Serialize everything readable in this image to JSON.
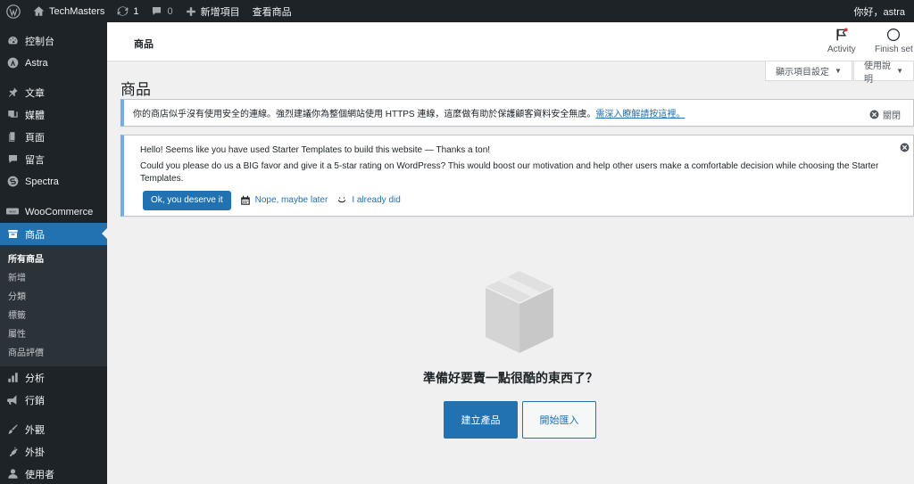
{
  "adminbar": {
    "site_name": "TechMasters",
    "updates_count": "1",
    "comments_count": "0",
    "new_label": "新增項目",
    "view_label": "查看商品",
    "greeting": "你好，astra"
  },
  "sidebar": {
    "dashboard": "控制台",
    "astra": "Astra",
    "posts": "文章",
    "media": "媒體",
    "pages": "頁面",
    "comments": "留言",
    "spectra": "Spectra",
    "woocommerce": "WooCommerce",
    "products": "商品",
    "submenu": [
      "所有商品",
      "新增",
      "分類",
      "標籤",
      "屬性",
      "商品評價"
    ],
    "analytics": "分析",
    "marketing": "行銷",
    "appearance": "外觀",
    "plugins": "外掛",
    "users": "使用者"
  },
  "header": {
    "title": "商品",
    "activity": "Activity",
    "finish_setup": "Finish set"
  },
  "screen_options": "顯示項目設定",
  "help": "使用說明",
  "page_title": "商品",
  "https_notice": {
    "text": "你的商店似乎沒有使用安全的連線。強烈建議你為整個網站使用 HTTPS 連線，這麼做有助於保護顧客資料安全無虞。",
    "link": "需深入瞭解請按這裡。",
    "dismiss": "關閉"
  },
  "starter_notice": {
    "line1": "Hello! Seems like you have used Starter Templates to build this website — Thanks a ton!",
    "line2": "Could you please do us a BIG favor and give it a 5-star rating on WordPress? This would boost our motivation and help other users make a comfortable decision while choosing the Starter Templates.",
    "btn_yes": "Ok, you deserve it",
    "btn_later": "Nope, maybe later",
    "btn_did": "I already did"
  },
  "empty_state": {
    "title": "準備好要賣一點很酷的東西了？",
    "create": "建立產品",
    "import": "開始匯入"
  }
}
